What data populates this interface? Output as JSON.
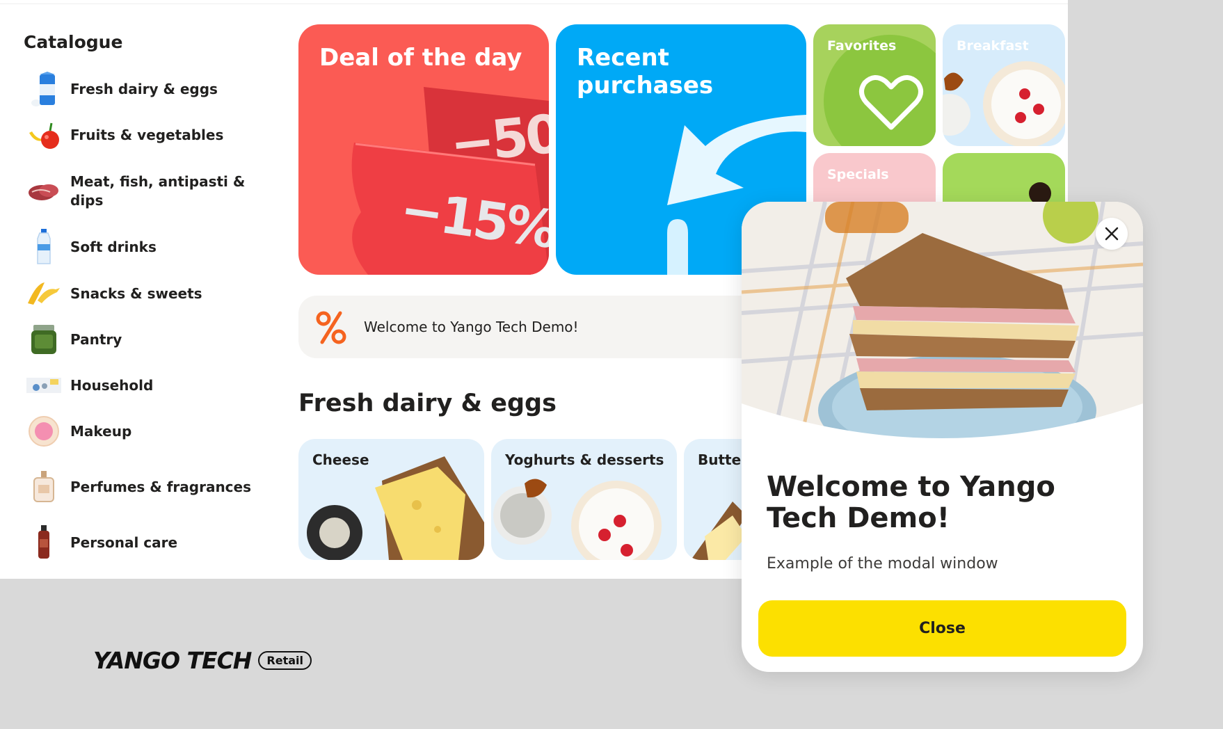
{
  "sidebar": {
    "title": "Catalogue",
    "items": [
      {
        "label": "Fresh dairy & eggs",
        "icon": "milk-carton-icon"
      },
      {
        "label": "Fruits & vegetables",
        "icon": "fruits-icon"
      },
      {
        "label": "Meat, fish, antipasti & dips",
        "icon": "meat-icon"
      },
      {
        "label": "Soft drinks",
        "icon": "water-bottle-icon"
      },
      {
        "label": "Snacks & sweets",
        "icon": "snacks-icon"
      },
      {
        "label": "Pantry",
        "icon": "jar-icon"
      },
      {
        "label": "Household",
        "icon": "household-icon"
      },
      {
        "label": "Makeup",
        "icon": "compact-powder-icon"
      },
      {
        "label": "Perfumes & fragrances",
        "icon": "perfume-bottle-icon"
      },
      {
        "label": "Personal care",
        "icon": "care-bottle-icon"
      }
    ]
  },
  "tiles": {
    "deal": {
      "title": "Deal of the day",
      "badge_big": "−50",
      "badge_small": "−15%"
    },
    "recent": {
      "title": "Recent purchases"
    },
    "favorites": {
      "title": "Favorites"
    },
    "breakfast": {
      "title": "Breakfast"
    },
    "specials": {
      "title": "Specials"
    }
  },
  "promo": {
    "text": "Welcome to Yango Tech Demo!",
    "icon": "percent-icon"
  },
  "section": {
    "title": "Fresh dairy & eggs",
    "subcategories": [
      {
        "label": "Cheese"
      },
      {
        "label": "Yoghurts & desserts"
      },
      {
        "label": "Butter,"
      }
    ]
  },
  "footer": {
    "logo_text": "YANGO TECH",
    "badge": "Retail"
  },
  "modal": {
    "title": "Welcome to Yango Tech Demo!",
    "description": "Example of the modal window",
    "button_label": "Close"
  },
  "colors": {
    "accent_yellow": "#fce000",
    "deal_red": "#fb5b54",
    "recent_blue": "#00a9f6"
  }
}
